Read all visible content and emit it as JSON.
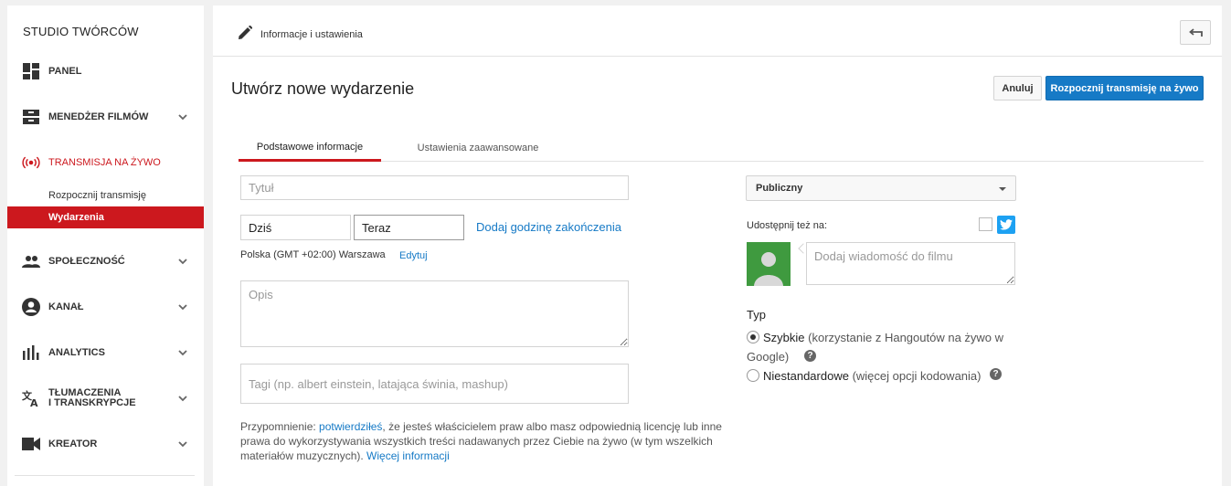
{
  "sidebar": {
    "title": "STUDIO TWÓRCÓW",
    "items": [
      {
        "label": "PANEL"
      },
      {
        "label": "MENEDŻER FILMÓW"
      },
      {
        "label": "TRANSMISJA NA ŻYWO"
      },
      {
        "label": "SPOŁECZNOŚĆ"
      },
      {
        "label": "KANAŁ"
      },
      {
        "label": "ANALYTICS"
      },
      {
        "label": "TŁUMACZENIA\nI TRANSKRYPCJE"
      },
      {
        "label": "KREATOR"
      }
    ],
    "live_subitems": [
      {
        "label": "Rozpocznij transmisję"
      },
      {
        "label": "Wydarzenia"
      }
    ],
    "accent": "#cc181e"
  },
  "header": {
    "title": "Informacje i ustawienia"
  },
  "page": {
    "title": "Utwórz nowe wydarzenie",
    "cancel_label": "Anuluj",
    "start_label": "Rozpocznij transmisję na żywo",
    "primary_color": "#167ac6"
  },
  "tabs": [
    {
      "label": "Podstawowe informacje",
      "active": true
    },
    {
      "label": "Ustawienia zaawansowane",
      "active": false
    }
  ],
  "form": {
    "title_placeholder": "Tytuł",
    "date_value": "Dziś",
    "time_value": "Teraz",
    "add_end_time": "Dodaj godzinę zakończenia",
    "timezone": "Polska (GMT +02:00) Warszawa",
    "edit_label": "Edytuj",
    "description_placeholder": "Opis",
    "tags_placeholder": "Tagi (np. albert einstein, latająca świnia, mashup)",
    "note": {
      "prefix": "Przypomnienie: ",
      "link1": "potwierdziłeś",
      "middle": ", że jesteś właścicielem praw albo masz odpowiednią licencję lub inne prawa do wykorzystywania wszystkich treści nadawanych przez Ciebie na żywo (w tym wszelkich materiałów muzycznych). ",
      "link2": "Więcej informacji"
    }
  },
  "right": {
    "privacy_value": "Publiczny",
    "share_label": "Udostępnij też na:",
    "message_placeholder": "Dodaj wiadomość do filmu",
    "type_heading": "Typ",
    "options": [
      {
        "name": "Szybkie",
        "detail": "(korzystanie z Hangoutów na żywo w Google)",
        "selected": true
      },
      {
        "name": "Niestandardowe",
        "detail": "(więcej opcji kodowania)",
        "selected": false
      }
    ]
  }
}
